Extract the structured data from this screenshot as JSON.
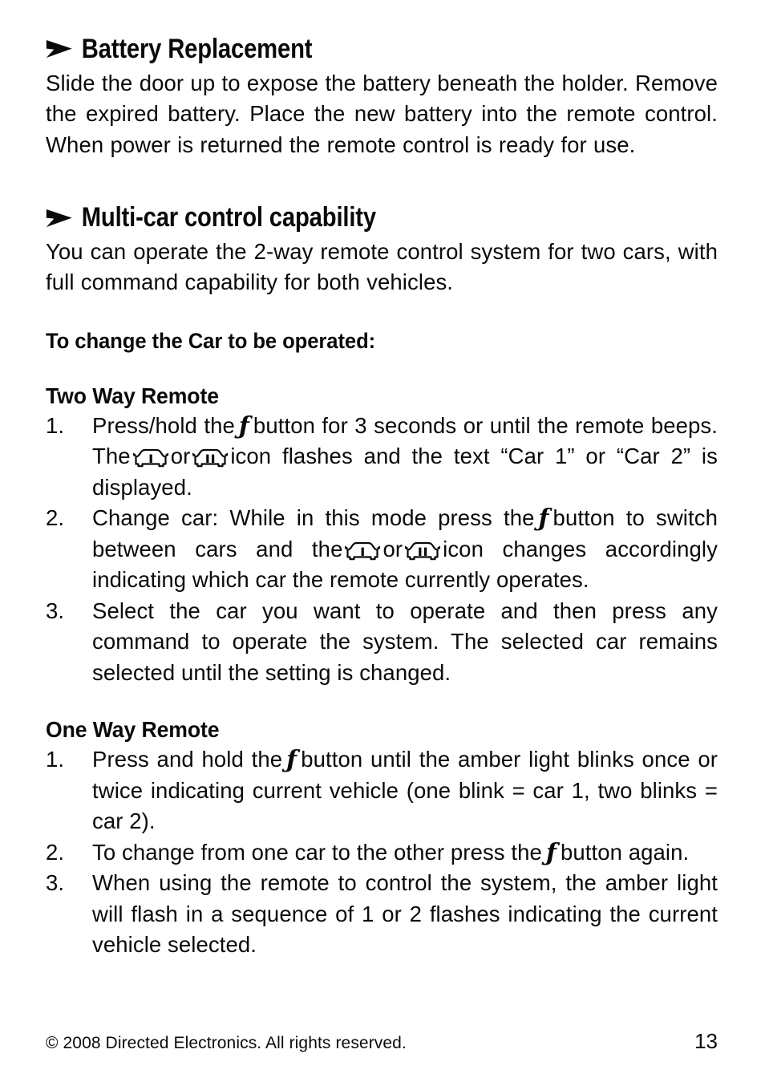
{
  "page": {
    "number": "13",
    "copyright": "© 2008 Directed Electronics. All rights reserved."
  },
  "icons": {
    "bullet": "arrow-bullet-icon",
    "function_button": "ƒ",
    "car_one": "car-one-icon",
    "car_two": "car-two-icon"
  },
  "sections": [
    {
      "heading": "Battery Replacement",
      "body": "Slide the door up to expose the battery beneath the holder.  Remove the expired battery. Place the new battery into the remote control. When power is returned the remote control is ready for use."
    },
    {
      "heading": "Multi-car control capability",
      "body": "You can operate the 2-way remote control system for two cars, with full command capability for both vehicles."
    }
  ],
  "lead_line": "To change the Car to be operated:",
  "two_way": {
    "subheading": "Two Way Remote",
    "items": [
      {
        "number": "1.",
        "part1": "Press/hold the",
        "part2": "button for 3 seconds or until the remote beeps. The",
        "part3": "or",
        "part4": "icon flashes and the text “Car 1” or “Car 2” is displayed."
      },
      {
        "number": "2.",
        "part1": "Change car: While in this mode press the",
        "part2": "button to switch between cars and the",
        "part3": "or",
        "part4": "icon changes accordingly indicating which car the remote currently operates."
      },
      {
        "number": "3.",
        "text": "Select the car you want to operate and then press any command to operate the system. The selected car remains selected until the setting is changed."
      }
    ]
  },
  "one_way": {
    "subheading": "One Way Remote",
    "items": [
      {
        "number": "1.",
        "part1": "Press and hold the",
        "part2": "button until the amber light blinks once or twice indicating current vehicle (one blink = car 1, two blinks = car 2)."
      },
      {
        "number": "2.",
        "part1": "To change from one car to the other press the",
        "part2": "button again."
      },
      {
        "number": "3.",
        "text": "When using the remote to control the system, the amber light will flash in a sequence of 1 or 2 flashes indicating the current vehicle selected."
      }
    ]
  }
}
